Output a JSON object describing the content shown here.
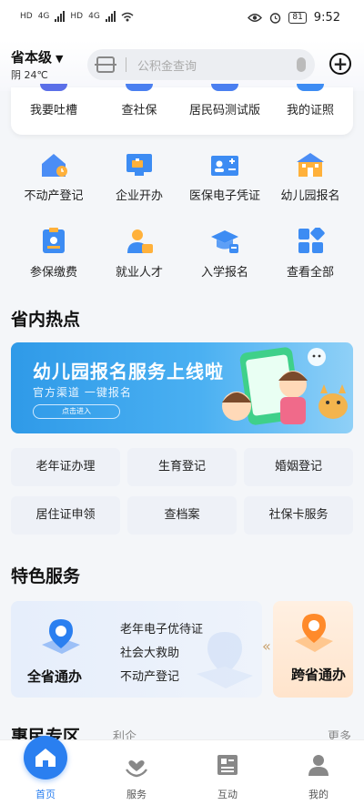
{
  "statusbar": {
    "left_tag_1": "HD",
    "left_tag_2": "HD",
    "net_1": "4G",
    "net_2": "4G",
    "battery": "81",
    "time": "9:52"
  },
  "header": {
    "location": "省本级",
    "weather": "阴 24℃",
    "search_placeholder": "公积金查询"
  },
  "top_card": {
    "items": [
      "我要吐槽",
      "查社保",
      "居民码测试版",
      "我的证照"
    ]
  },
  "services": {
    "items": [
      {
        "label": "不动产登记",
        "icon": "house-icon"
      },
      {
        "label": "企业开办",
        "icon": "business-icon"
      },
      {
        "label": "医保电子凭证",
        "icon": "medical-card-icon"
      },
      {
        "label": "幼儿园报名",
        "icon": "school-building-icon"
      },
      {
        "label": "参保缴费",
        "icon": "insurance-icon"
      },
      {
        "label": "就业人才",
        "icon": "talent-icon"
      },
      {
        "label": "入学报名",
        "icon": "graduation-cap-icon"
      },
      {
        "label": "查看全部",
        "icon": "grid-all-icon"
      }
    ]
  },
  "hot": {
    "title": "省内热点",
    "banner": {
      "title": "幼儿园报名服务上线啦",
      "subtitle": "官方渠道 一键报名",
      "button": "点击进入"
    },
    "buttons": [
      "老年证办理",
      "生育登记",
      "婚姻登记",
      "居住证申领",
      "查档案",
      "社保卡服务"
    ]
  },
  "featured": {
    "title": "特色服务",
    "main_title": "全省通办",
    "main_items": [
      "老年电子优待证",
      "社会大救助",
      "不动产登记"
    ],
    "side_title": "跨省通办",
    "arrow": "«"
  },
  "peek_section": {
    "title": "惠民专区",
    "mid": "利企",
    "more": "更多"
  },
  "tabbar": {
    "tabs": [
      "首页",
      "服务",
      "互动",
      "我的"
    ]
  },
  "colors": {
    "accent": "#2a7ff0",
    "banner": "#3aa3ee",
    "hot_button_bg": "#eef1f7"
  }
}
